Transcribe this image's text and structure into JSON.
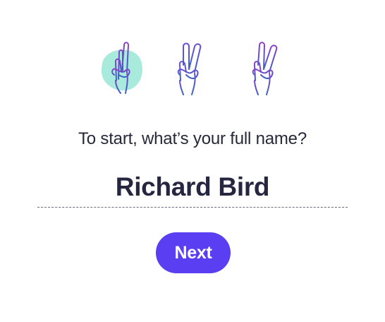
{
  "steps": {
    "total": 3,
    "current": 1,
    "items": [
      {
        "icon": "peace-hand-icon",
        "status": "active"
      },
      {
        "icon": "peace-hand-icon",
        "status": "inactive"
      },
      {
        "icon": "peace-hand-icon",
        "status": "inactive"
      }
    ]
  },
  "form": {
    "question": "To start, what’s your full name?",
    "name_value": "Richard Bird",
    "next_label": "Next"
  },
  "colors": {
    "accent": "#5a3ef2",
    "highlight": "#a8eadb",
    "hand_blue": "#3b64c4",
    "hand_purple": "#8a3fc9",
    "text": "#27283a"
  }
}
